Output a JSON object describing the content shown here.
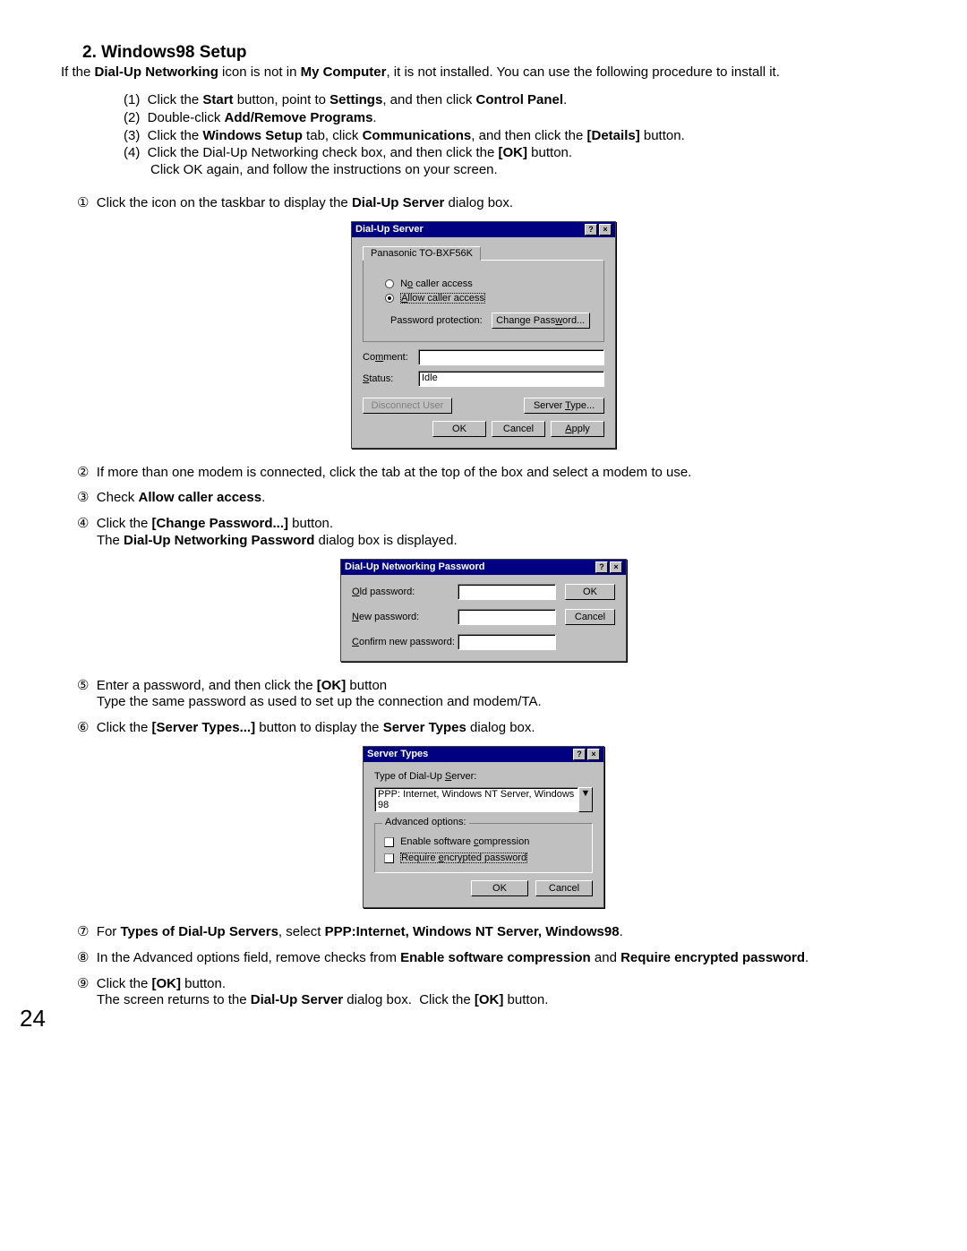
{
  "section_number": "2.",
  "section_title": "Windows98 Setup",
  "intro_prefix": "If the ",
  "intro_bold1": "Dial-Up Networking",
  "intro_mid1": " icon is not in ",
  "intro_bold2": "My Computer",
  "intro_suffix": ", it is not installed.  You can use the following procedure to install it.",
  "install_list": {
    "i1": "(1)  Click the Start button, point to Settings, and then click Control Panel.",
    "i2": "(2)  Double-click Add/Remove Programs.",
    "i3": "(3)  Click the Windows Setup tab, click Communications, and then click the [Details] button.",
    "i4": "(4)  Click the Dial-Up Networking check box, and then click the [OK] button.",
    "i5": "Click OK again, and follow the instructions on your screen."
  },
  "step1": {
    "num": "①",
    "text": "Click the icon on the taskbar to display the Dial-Up Server dialog box."
  },
  "step2": {
    "num": "②",
    "text": "If more than one modem is connected, click the tab at the top of the box and select a modem to use."
  },
  "step3": {
    "num": "③",
    "text": "Check Allow caller access."
  },
  "step4": {
    "num": "④",
    "line1": "Click the [Change Password...] button.",
    "line2": "The Dial-Up Networking Password dialog box is displayed."
  },
  "step5": {
    "num": "⑤",
    "line1": "Enter a password, and then click the [OK] button",
    "line2": "Type the same password as used to set up the connection and modem/TA."
  },
  "step6": {
    "num": "⑥",
    "text": "Click the [Server Types...] button to display the Server Types dialog box."
  },
  "step7": {
    "num": "⑦",
    "text": "For Types of Dial-Up Servers, select PPP:Internet, Windows NT Server, Windows98."
  },
  "step8": {
    "num": "⑧",
    "text": "In the Advanced options field, remove checks from Enable software compression and Require encrypted password."
  },
  "step9": {
    "num": "⑨",
    "line1": "Click the [OK] button.",
    "line2": "The screen returns to the Dial-Up Server dialog box.  Click the [OK] button."
  },
  "dlg1": {
    "title": "Dial-Up Server",
    "tab": "Panasonic TO-BXF56K",
    "opt_no": "No caller access",
    "opt_allow": "Allow caller access",
    "pwd_label": "Password protection:",
    "change_pwd": "Change Password...",
    "comment_label": "Comment:",
    "status_label": "Status:",
    "status_val": "Idle",
    "discon": "Disconnect User",
    "server_type": "Server Type...",
    "ok": "OK",
    "cancel": "Cancel",
    "apply": "Apply"
  },
  "dlg2": {
    "title": "Dial-Up Networking Password",
    "old": "Old password:",
    "new": "New password:",
    "confirm": "Confirm new password:",
    "ok": "OK",
    "cancel": "Cancel"
  },
  "dlg3": {
    "title": "Server Types",
    "type_label": "Type of Dial-Up Server:",
    "type_value": "PPP: Internet, Windows NT Server, Windows 98",
    "adv_legend": "Advanced options:",
    "softcomp": "Enable software compression",
    "reqenc": "Require encrypted password",
    "ok": "OK",
    "cancel": "Cancel"
  },
  "page_num": "24"
}
